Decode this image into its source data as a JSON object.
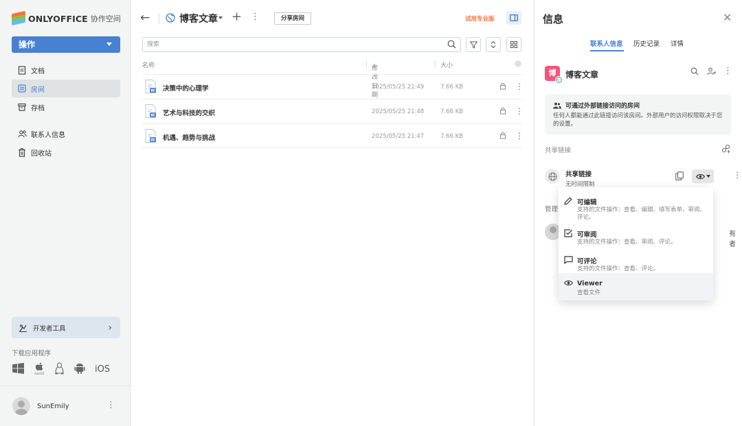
{
  "sidebar": {
    "logo_text": "ONLYOFFICE",
    "logo_sub": "协作空间",
    "action_label": "操作",
    "nav": [
      {
        "label": "文档",
        "icon": "document-icon"
      },
      {
        "label": "房间",
        "icon": "rooms-icon"
      },
      {
        "label": "存档",
        "icon": "archive-icon"
      },
      {
        "label": "联系人信息",
        "icon": "contacts-icon"
      },
      {
        "label": "回收站",
        "icon": "trash-icon"
      }
    ],
    "dev_tools": "开发者工具",
    "download_title": "下载应用程序",
    "ios_label": "iOS",
    "user_name": "SunEmily"
  },
  "topbar": {
    "room_title": "博客文章",
    "share_room": "分享房间",
    "trial": "试用专业版"
  },
  "search": {
    "placeholder": "搜索"
  },
  "table": {
    "col_name": "名称",
    "col_modified": "修改日期",
    "col_size": "大小",
    "rows": [
      {
        "name": "决策中的心理学",
        "date": "2025/05/25 21:49",
        "size": "7.66 KB"
      },
      {
        "name": "艺术与科技的交织",
        "date": "2025/05/25 21:48",
        "size": "7.66 KB"
      },
      {
        "name": "机遇、趋势与挑战",
        "date": "2025/05/25 21:47",
        "size": "7.66 KB"
      }
    ]
  },
  "info": {
    "title": "信息",
    "tabs": [
      "联系人信息",
      "历史记录",
      "详情"
    ],
    "room_avatar_letter": "博",
    "room_name": "博客文章",
    "notice_title": "可通过外部链接访问的房间",
    "notice_desc": "任何人都能通过此链接访问该房间。外部用户的访问权限取决于您的设置。",
    "share_links_heading": "共享链接",
    "link_title": "共享链接",
    "link_sub": "无时间限制",
    "manager_label": "管理",
    "owner_text": "有者"
  },
  "dropdown": {
    "items": [
      {
        "title": "可编辑",
        "desc": "支持的文件操作：查看、编辑、填写表单、审阅、评论。",
        "icon": "pencil-icon"
      },
      {
        "title": "可审阅",
        "desc": "支持的文件操作：查看、审阅、评论。",
        "icon": "review-icon"
      },
      {
        "title": "可评论",
        "desc": "支持的文件操作：查看、评论。",
        "icon": "comment-icon"
      },
      {
        "title": "Viewer",
        "desc": "查看文件",
        "icon": "eye-icon"
      }
    ]
  },
  "colors": {
    "accent": "#4781d1",
    "trial": "#ff6f3d",
    "room_avatar": "#f2557a"
  }
}
